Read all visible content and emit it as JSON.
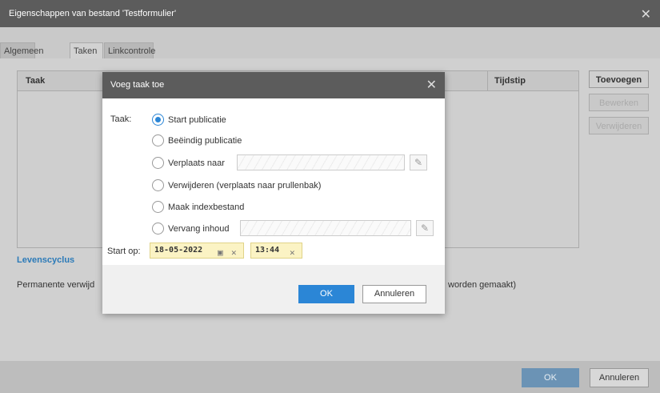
{
  "window": {
    "title": "Eigenschappen van bestand 'Testformulier'",
    "close_glyph": "✕"
  },
  "tabs": [
    {
      "label": "Algemeen"
    },
    {
      "label": "Taken"
    },
    {
      "label": "Linkcontrole"
    }
  ],
  "table": {
    "columns": [
      "Taak",
      "Tijdstip"
    ]
  },
  "side_buttons": {
    "add": "Toevoegen",
    "edit": "Bewerken",
    "delete": "Verwijderen"
  },
  "lifecycle": {
    "title": "Levenscyclus",
    "text_left": "Permanente verwijd",
    "text_right": "worden gemaakt)"
  },
  "footer": {
    "ok": "OK",
    "cancel": "Annuleren"
  },
  "dialog": {
    "title": "Voeg taak toe",
    "close_glyph": "✕",
    "task_label": "Taak:",
    "options": [
      {
        "label": "Start publicatie",
        "checked": true
      },
      {
        "label": "Beëindig publicatie",
        "checked": false
      },
      {
        "label": "Verplaats naar",
        "checked": false
      },
      {
        "label": "Verwijderen (verplaats naar prullenbak)",
        "checked": false
      },
      {
        "label": "Maak indexbestand",
        "checked": false
      },
      {
        "label": "Vervang inhoud",
        "checked": false
      }
    ],
    "start_label": "Start op:",
    "date": "18-05-2022",
    "time": "13:44",
    "ok": "OK",
    "cancel": "Annuleren",
    "icons": {
      "pencil": "✎",
      "calendar": "▣",
      "clear": "✕"
    }
  }
}
